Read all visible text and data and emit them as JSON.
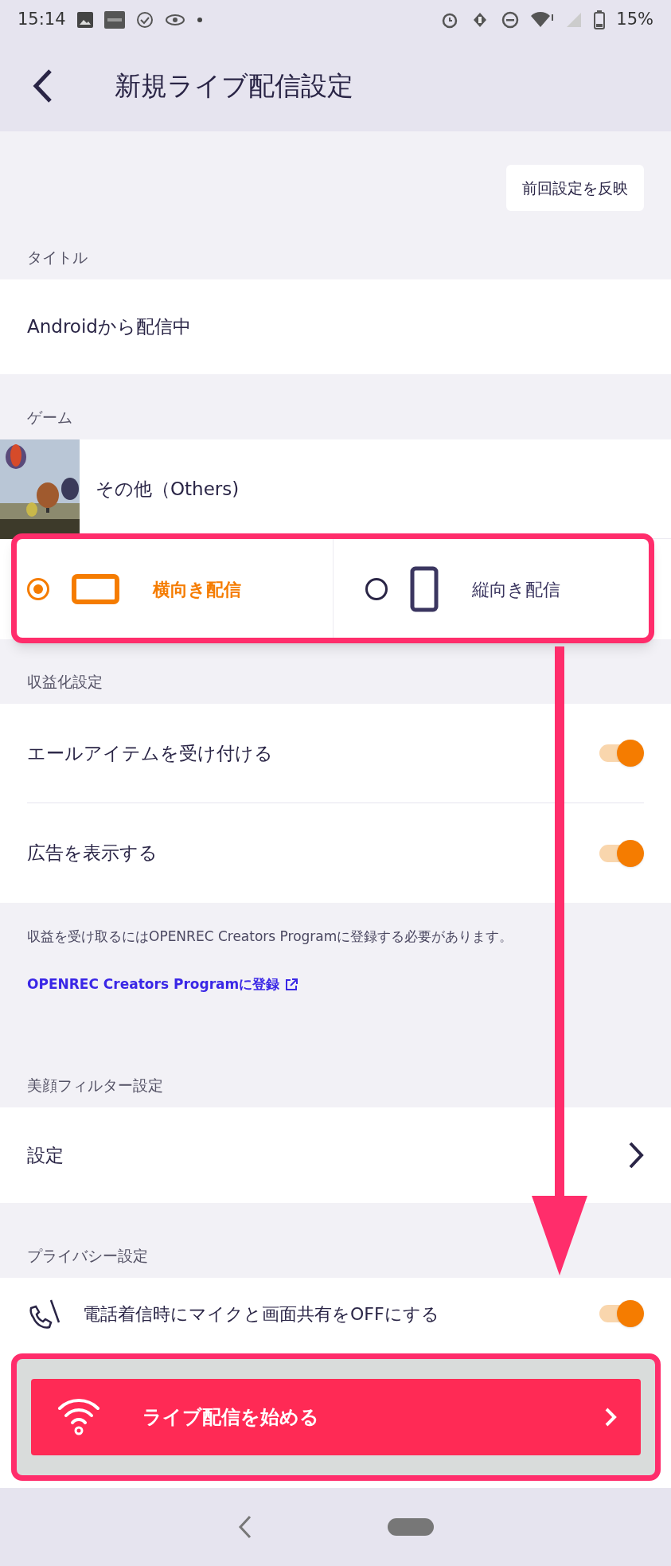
{
  "status_bar": {
    "time": "15:14",
    "battery": "15%"
  },
  "header": {
    "title": "新規ライブ配信設定"
  },
  "reflect_button": "前回設定を反映",
  "title_section": {
    "label": "タイトル",
    "value": "Androidから配信中"
  },
  "game_section": {
    "label": "ゲーム",
    "game": {
      "name": "その他（Others)",
      "kind": "picture"
    }
  },
  "orientation": [
    {
      "label": "横向き配信",
      "kind": "landscape",
      "selected": true
    },
    {
      "label": "縦向き配信",
      "kind": "portrait",
      "selected": false
    }
  ],
  "monetization": {
    "label": "収益化設定",
    "toggles": [
      {
        "label": "エールアイテムを受け付ける",
        "on": true
      },
      {
        "label": "広告を表示する",
        "on": true
      }
    ],
    "note": "収益を受け取るにはOPENREC Creators Programに登録する必要があります。",
    "link": "OPENREC Creators Programに登録"
  },
  "beauty": {
    "label": "美顔フィルター設定",
    "item": "設定"
  },
  "privacy": {
    "label": "プライバシー設定",
    "toggle": {
      "label": "電話着信時にマイクと画面共有をOFFにする",
      "on": true
    }
  },
  "start_button": "ライブ配信を始める"
}
